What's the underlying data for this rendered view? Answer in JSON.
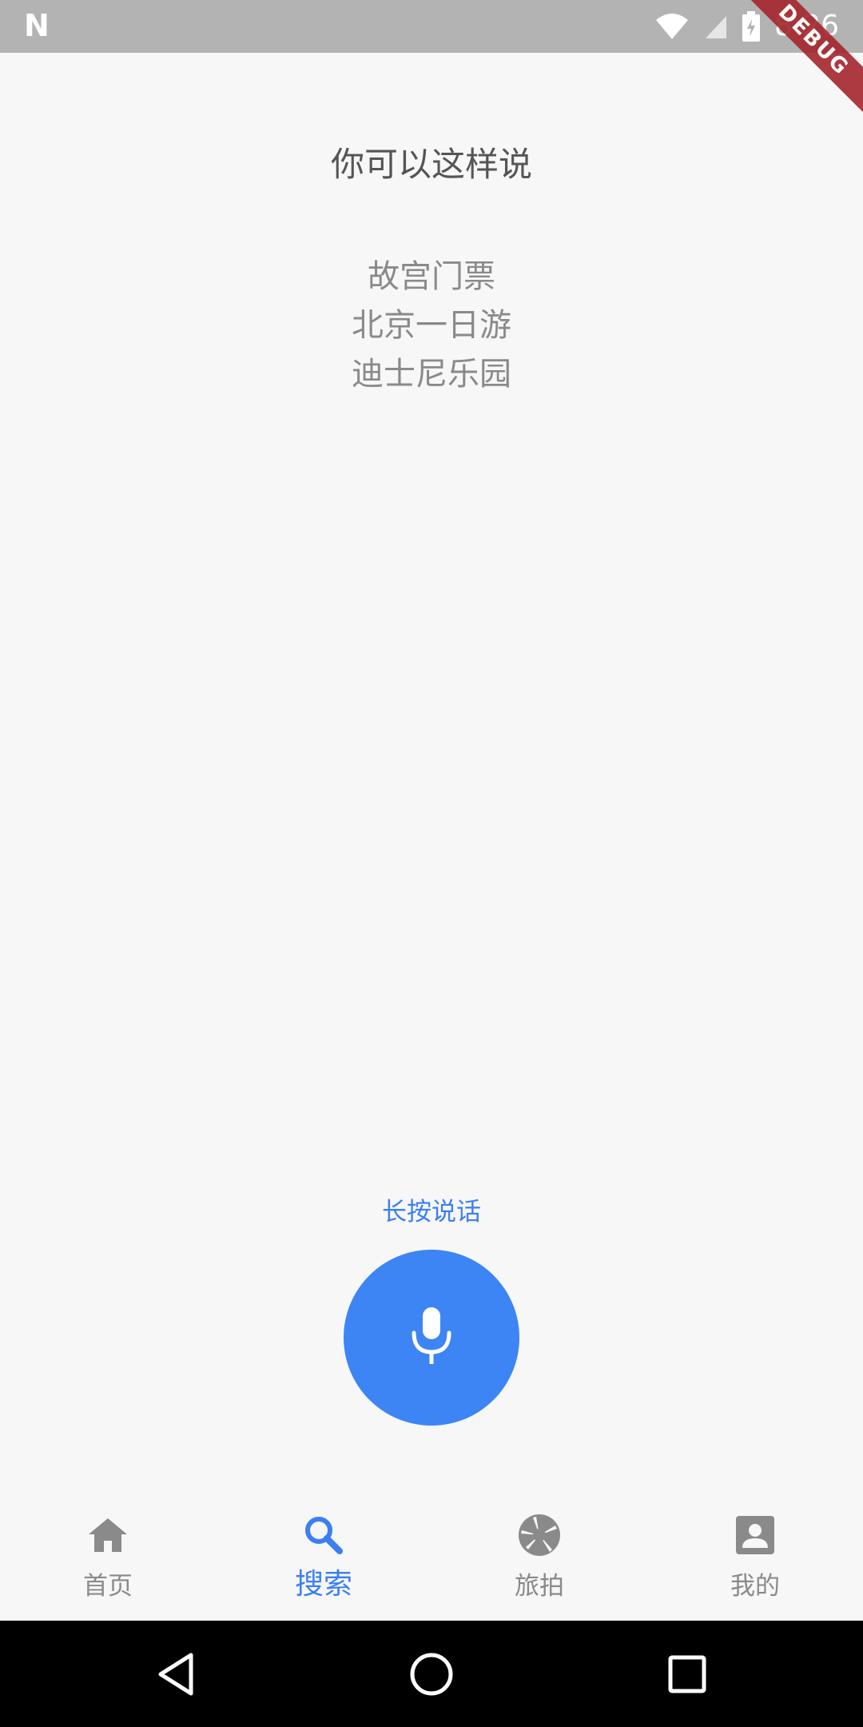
{
  "status_bar": {
    "carrier_icon": "N",
    "time": "8:26",
    "debug_banner": "DEBUG",
    "icons": [
      "wifi-icon",
      "signal-icon",
      "battery-icon"
    ]
  },
  "voice_search": {
    "title": "你可以这样说",
    "suggestions": [
      "故宫门票",
      "北京一日游",
      "迪士尼乐园"
    ],
    "press_hint": "长按说话",
    "mic_icon": "microphone-icon",
    "accent_color": "#3d85f5"
  },
  "bottom_nav": {
    "items": [
      {
        "label": "首页",
        "icon": "home-icon",
        "active": false
      },
      {
        "label": "搜索",
        "icon": "search-icon",
        "active": true
      },
      {
        "label": "旅拍",
        "icon": "camera-aperture-icon",
        "active": false
      },
      {
        "label": "我的",
        "icon": "account-box-icon",
        "active": false
      }
    ],
    "active_color": "#3b7ff2",
    "inactive_color": "#8a8a8a"
  },
  "system_nav": {
    "buttons": [
      "back-icon",
      "home-circle-icon",
      "recents-icon"
    ]
  }
}
